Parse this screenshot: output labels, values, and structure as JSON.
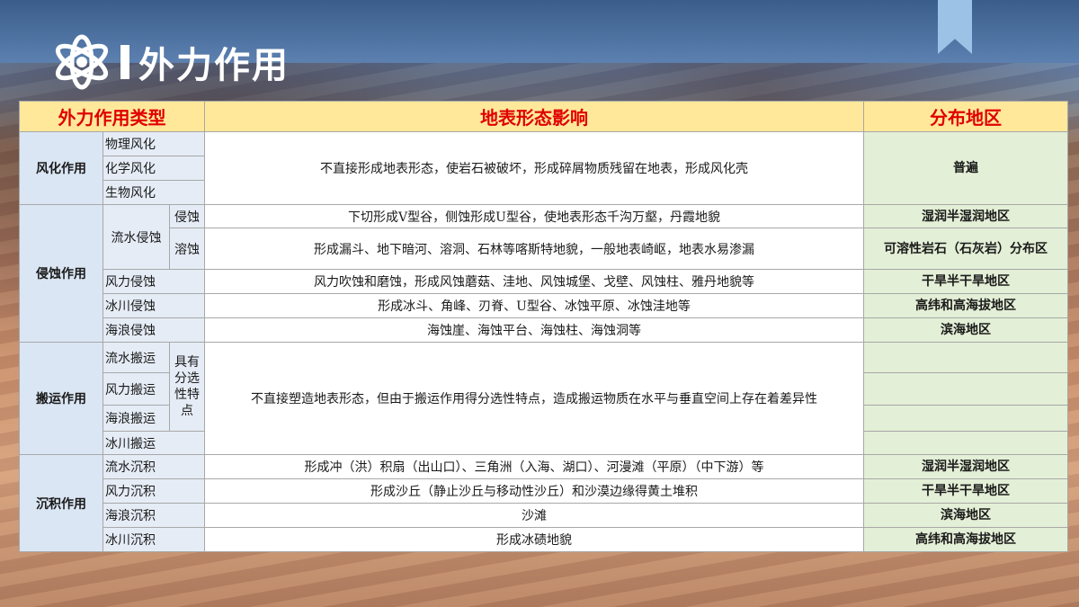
{
  "header": {
    "title": "外力作用",
    "logo_icon": "atom-icon"
  },
  "colors": {
    "category": "#4aa02c",
    "subtype": "#6a2a8a",
    "distribution": "#e87b22",
    "header_text": "#e00000",
    "header_bg": "#ffe89a"
  },
  "table": {
    "headers": [
      "外力作用类型",
      "地表形态影响",
      "分布地区"
    ],
    "weathering": {
      "category": "风化作用",
      "types": [
        "物理风化",
        "化学风化",
        "生物风化"
      ],
      "effect": "不直接形成地表形态，使岩石被破坏，形成碎屑物质残留在地表，形成风化壳",
      "distribution": "普遍"
    },
    "erosion": {
      "category": "侵蚀作用",
      "water_erosion": "流水侵蚀",
      "water_subtypes": [
        {
          "name": "侵蚀",
          "effect": "下切形成V型谷，侧蚀形成U型谷，使地表形态千沟万壑，丹霞地貌",
          "distribution": "湿润半湿润地区"
        },
        {
          "name": "溶蚀",
          "effect": "形成漏斗、地下暗河、溶洞、石林等喀斯特地貌，一般地表崎岖，地表水易渗漏",
          "distribution": "可溶性岩石（石灰岩）分布区"
        }
      ],
      "others": [
        {
          "name": "风力侵蚀",
          "effect": "风力吹蚀和磨蚀，形成风蚀蘑菇、洼地、风蚀城堡、戈壁、风蚀柱、雅丹地貌等",
          "distribution": "干旱半干旱地区"
        },
        {
          "name": "冰川侵蚀",
          "effect": "形成冰斗、角峰、刃脊、U型谷、冰蚀平原、冰蚀洼地等",
          "distribution": "高纬和高海拔地区"
        },
        {
          "name": "海浪侵蚀",
          "effect": "海蚀崖、海蚀平台、海蚀柱、海蚀洞等",
          "distribution": "滨海地区"
        }
      ]
    },
    "transport": {
      "category": "搬运作用",
      "types": [
        "流水搬运",
        "风力搬运",
        "海浪搬运",
        "冰川搬运"
      ],
      "selectivity": "具有分选性特点",
      "effect": "不直接塑造地表形态，但由于搬运作用得分选性特点，造成搬运物质在水平与垂直空间上存在着差异性"
    },
    "deposition": {
      "category": "沉积作用",
      "rows": [
        {
          "name": "流水沉积",
          "effect": "形成冲（洪）积扇（出山口）、三角洲（入海、湖口）、河漫滩（平原）（中下游）等",
          "distribution": "湿润半湿润地区"
        },
        {
          "name": "风力沉积",
          "effect": "形成沙丘（静止沙丘与移动性沙丘）和沙漠边缘得黄土堆积",
          "distribution": "干旱半干旱地区"
        },
        {
          "name": "海浪沉积",
          "effect": "沙滩",
          "distribution": "滨海地区"
        },
        {
          "name": "冰川沉积",
          "effect": "形成冰碛地貌",
          "distribution": "高纬和高海拔地区"
        }
      ]
    }
  }
}
